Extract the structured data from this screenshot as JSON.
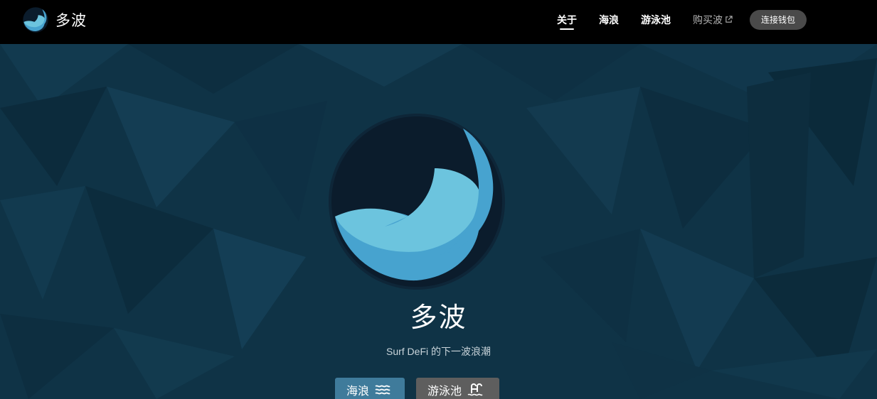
{
  "brand": {
    "name": "多波",
    "icon": "wave-logo-icon"
  },
  "nav": {
    "about": "关于",
    "waves": "海浪",
    "pools": "游泳池",
    "buy": "购买波",
    "buy_icon": "external-link-icon",
    "connect_wallet": "连接钱包"
  },
  "hero": {
    "title": "多波",
    "subtitle": "Surf DeFi 的下一波浪潮",
    "buttons": {
      "waves": {
        "label": "海浪",
        "icon": "waves-icon"
      },
      "pools": {
        "label": "游泳池",
        "icon": "pool-ladder-icon"
      }
    }
  },
  "colors": {
    "navbar": "#000000",
    "hero_bg": "#0f3346",
    "accent_light": "#6cc4de",
    "accent_mid": "#47a3cf",
    "logo_dark": "#0b1c2c",
    "waves_button": "#3f7b9b",
    "pools_button": "#5e5e5e",
    "connect_button": "#4a4a4a"
  }
}
